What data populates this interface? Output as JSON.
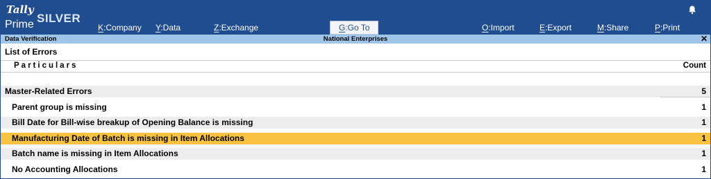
{
  "app": {
    "logo_top": "Tally",
    "logo_bottom": "Prime",
    "edition": "SILVER"
  },
  "menu": [
    {
      "key": "K",
      "label": ":Company"
    },
    {
      "key": "Y",
      "label": ":Data"
    },
    {
      "key": "Z",
      "label": ":Exchange"
    },
    {
      "key": "G",
      "label": ":Go To"
    },
    {
      "key": "O",
      "label": ":Import"
    },
    {
      "key": "E",
      "label": ":Export"
    },
    {
      "key": "M",
      "label": ":Share"
    },
    {
      "key": "P",
      "label": ":Print"
    }
  ],
  "titlebar": {
    "left": "Data Verification",
    "center": "National Enterprises",
    "close": "✕"
  },
  "report": {
    "title": "List of Errors",
    "columns": {
      "particulars": "Particulars",
      "count": "Count"
    },
    "group": {
      "label": "Master-Related Errors",
      "count": "5"
    },
    "rows": [
      {
        "label": "Parent group is missing",
        "count": "1"
      },
      {
        "label": "Bill Date for Bill-wise breakup of Opening Balance is missing",
        "count": "1"
      },
      {
        "label": "Manufacturing Date of Batch is missing in Item Allocations",
        "count": "1"
      },
      {
        "label": "Batch name is missing in Item Allocations",
        "count": "1"
      },
      {
        "label": "No Accounting Allocations",
        "count": "1"
      }
    ]
  },
  "colors": {
    "topbar": "#1f4d8f",
    "titlebar": "#9fc5e8",
    "selected_row": "#f9c341",
    "shaded_row": "#ededed"
  },
  "icons": {
    "notification": "bell-icon",
    "close": "close-icon"
  }
}
